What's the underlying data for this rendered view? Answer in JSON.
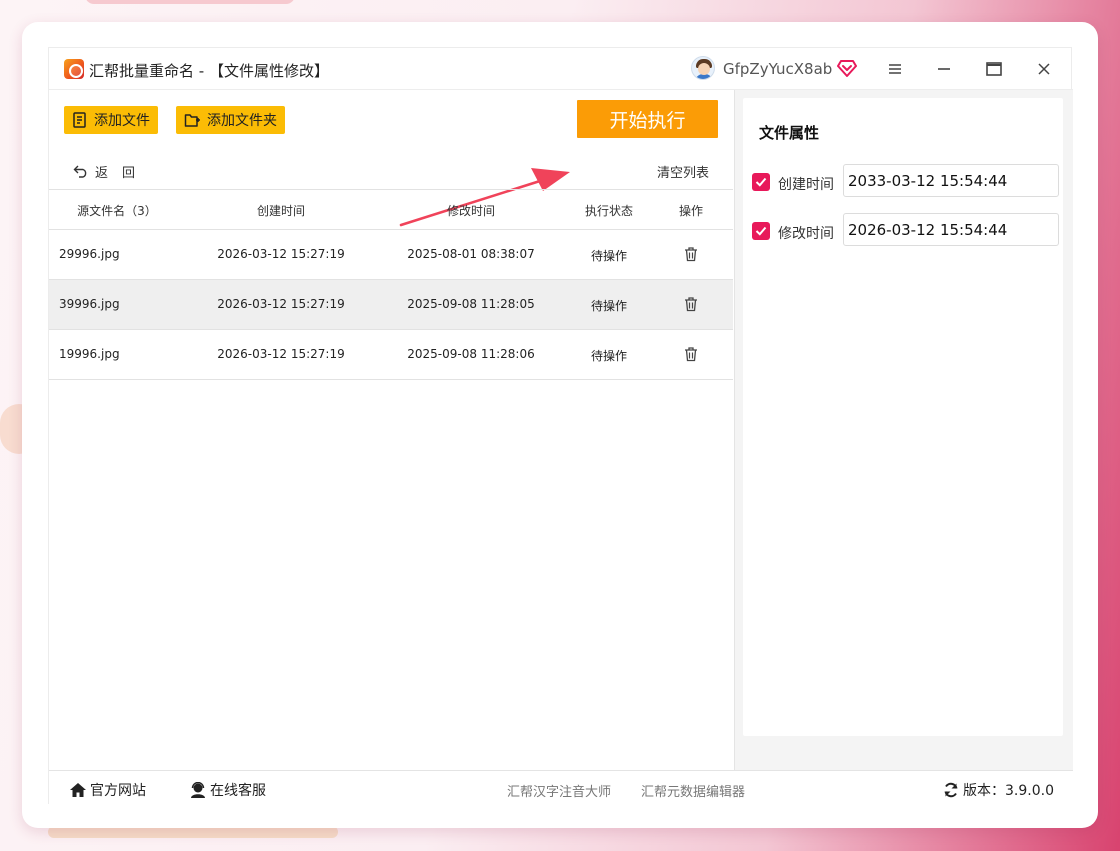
{
  "app": {
    "title": "汇帮批量重命名 - 【文件属性修改】",
    "user_name": "GfpZyYucX8ab"
  },
  "window_controls": [
    "menu-icon",
    "minimize-icon",
    "maximize-icon",
    "close-icon"
  ],
  "toolbar": {
    "add_file_label": "添加文件",
    "add_folder_label": "添加文件夹",
    "start_label": "开始执行",
    "back_label": "返回",
    "clear_list_label": "清空列表"
  },
  "table": {
    "headers": {
      "name": "源文件名（3）",
      "created": "创建时间",
      "modified": "修改时间",
      "status": "执行状态",
      "action": "操作"
    },
    "rows": [
      {
        "name": "29996.jpg",
        "created": "2026-03-12 15:27:19",
        "modified": "2025-08-01 08:38:07",
        "status": "待操作"
      },
      {
        "name": "39996.jpg",
        "created": "2026-03-12 15:27:19",
        "modified": "2025-09-08 11:28:05",
        "status": "待操作"
      },
      {
        "name": "19996.jpg",
        "created": "2026-03-12 15:27:19",
        "modified": "2025-09-08 11:28:06",
        "status": "待操作"
      }
    ]
  },
  "properties": {
    "title": "文件属性",
    "created_label": "创建时间",
    "created_value": "2033-03-12 15:54:44",
    "created_checked": true,
    "modified_label": "修改时间",
    "modified_value": "2026-03-12 15:54:44",
    "modified_checked": true
  },
  "footer": {
    "website_label": "官方网站",
    "support_label": "在线客服",
    "link1_label": "汇帮汉字注音大师",
    "link2_label": "汇帮元数据编辑器",
    "version_label": "版本：3.9.0.0"
  },
  "colors": {
    "yellow_button": "#fbbc05",
    "start_button": "#fb9c06",
    "checkbox": "#e8195a",
    "arrow": "#f0435a"
  }
}
